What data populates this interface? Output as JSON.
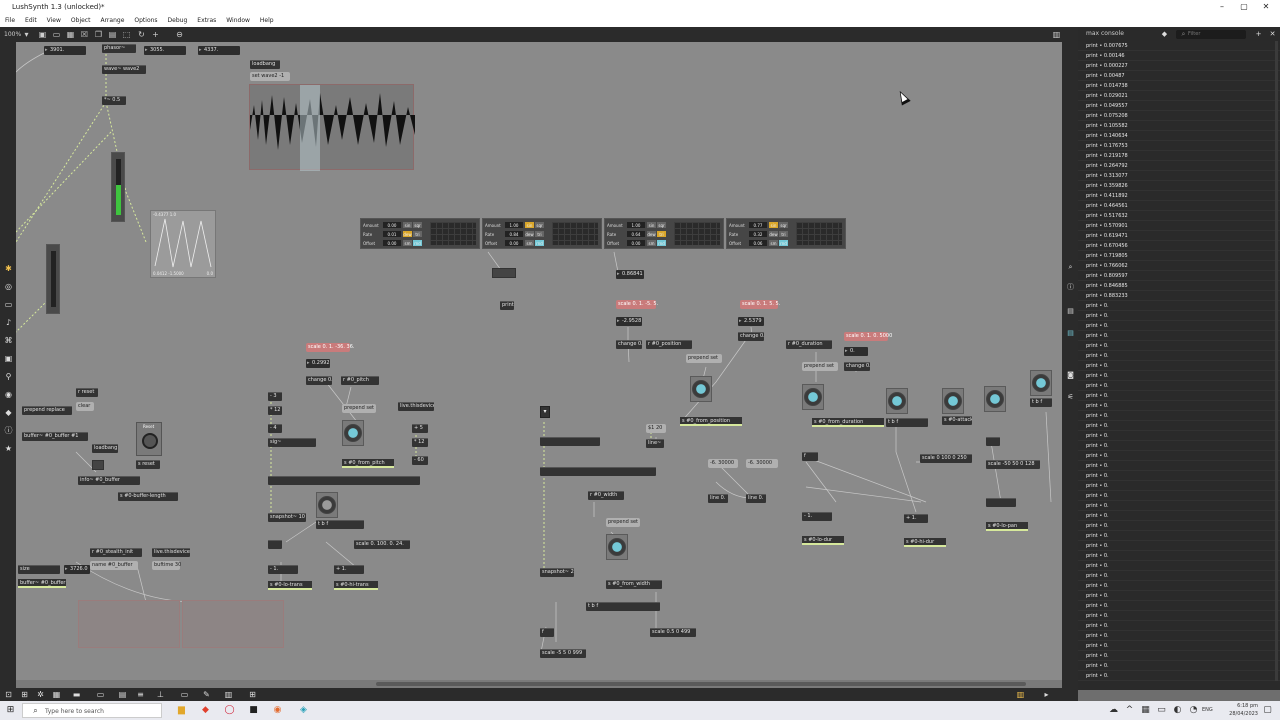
{
  "window": {
    "title": "LushSynth 1.3 (unlocked)*"
  },
  "menu": [
    "File",
    "Edit",
    "View",
    "Object",
    "Arrange",
    "Options",
    "Debug",
    "Extras",
    "Window",
    "Help"
  ],
  "toolbar": {
    "zoom": "100%"
  },
  "console": {
    "title": "max console",
    "filter_placeholder": "Filter",
    "lines": [
      "print • 0.007675",
      "print • 0.00146",
      "print • 0.000227",
      "print • 0.00487",
      "print • 0.014738",
      "print • 0.029021",
      "print • 0.049557",
      "print • 0.075208",
      "print • 0.105582",
      "print • 0.140634",
      "print • 0.176753",
      "print • 0.219178",
      "print • 0.264792",
      "print • 0.313077",
      "print • 0.359826",
      "print • 0.411892",
      "print • 0.464561",
      "print • 0.517632",
      "print • 0.570901",
      "print • 0.619471",
      "print • 0.670456",
      "print • 0.719805",
      "print • 0.766062",
      "print • 0.809597",
      "print • 0.846885",
      "print • 0.883233",
      "print • 0.",
      "print • 0.",
      "print • 0.",
      "print • 0.",
      "print • 0.",
      "print • 0.",
      "print • 0.",
      "print • 0.",
      "print • 0.",
      "print • 0.",
      "print • 0.",
      "print • 0.",
      "print • 0.",
      "print • 0.",
      "print • 0.",
      "print • 0.",
      "print • 0.",
      "print • 0.",
      "print • 0.",
      "print • 0.",
      "print • 0.",
      "print • 0.",
      "print • 0.",
      "print • 0.",
      "print • 0.",
      "print • 0.",
      "print • 0.",
      "print • 0.",
      "print • 0.",
      "print • 0.",
      "print • 0.",
      "print • 0.",
      "print • 0.",
      "print • 0.",
      "print • 0.",
      "print • 0.",
      "print • 0.",
      "print • 0."
    ]
  },
  "patch": {
    "top": {
      "num1": "3901.",
      "phasor": "phasor~",
      "num2": "3055.",
      "num3": "4337.",
      "wave": "wave~ wave2",
      "mult": "*~ 0.5",
      "loadbang": "loadbang",
      "set": "set wave2 -1"
    },
    "scope": {
      "range": "-0.4377 1.0",
      "left": "0.0412 -1.5000",
      "right": "0.0"
    },
    "lfo_panels": [
      {
        "amount": "0.00",
        "rate": "0.01",
        "offset": "0.00"
      },
      {
        "amount": "1.00",
        "rate": "0.84",
        "offset": "0.00"
      },
      {
        "amount": "1.00",
        "rate": "0.64",
        "offset": "0.00"
      },
      {
        "amount": "0.77",
        "rate": "0.32",
        "offset": "0.06"
      }
    ],
    "panel_labels": {
      "amount": "Amount",
      "rate": "Rate",
      "offset": "Offset",
      "sin": "sin",
      "sm": "sm",
      "dew": "dew",
      "tri": "tri",
      "sqr": "sqr",
      "rnd": "rnd"
    },
    "mid": {
      "num_a": "0.86841",
      "print": "print",
      "scale_a": "scale 0. 1. -5. 5.",
      "scale_b": "scale 0. 1. 5. 5.",
      "num_b": "-2.9528",
      "num_c": "2.5379",
      "change1": "change 0.",
      "change2": "change 0.",
      "r_position": "r #0_position",
      "prepend_set1": "prepend set",
      "s_from_position": "s #0_from_position",
      "msg_120": "$1 20",
      "line": "line~"
    },
    "pitch": {
      "scale": "scale 0. 1. -36. 36.",
      "num": "0.2992",
      "change": "change 0.",
      "r_pitch": "r #0_pitch",
      "prepend": "prepend set",
      "live": "live.thisdevice",
      "s_from_pitch": "s #0_from_pitch",
      "snapshot": "snapshot~ 10",
      "tbf": "t b f",
      "scale2": "scale 0. 100. 0. 24.",
      "minus1": "- 1.",
      "plus1": "+ 1.",
      "s_lo": "s #0-lo-trans",
      "s_hi": "s #0-hi-trans",
      "m3": "- 3",
      "m12": "* 12",
      "d4": "- 4",
      "p5": "+ 5",
      "p12": "* 12",
      "p60": "- 60",
      "sig": "sig~"
    },
    "buffer": {
      "r_reset": "r reset",
      "clear": "clear",
      "prepend_replace": "prepend replace",
      "buffer": "buffer~ #0_buffer #1",
      "loadbang": "loadbang",
      "reset_label": "Reset",
      "s_reset": "s reset",
      "info": "info~ #0_buffer",
      "s_len": "s #0-buffer-length",
      "size": "size",
      "num": "3726.0",
      "buffer2": "buffer~ #0_buffer",
      "r_stealth": "r #0_stealth_init",
      "name": "name #0_buffer",
      "live": "live.thisdevice",
      "buftime": "buftime 30"
    },
    "width": {
      "r_width": "r #0_width",
      "prepend": "prepend set",
      "s_from_width": "s #0_from_width",
      "snapshot": "snapshot~ 2",
      "tbf": "t b f",
      "f": "f",
      "scale": "scale 0.5 0 499",
      "scale2": "scale -5 5 0 999",
      "line0": "line 0.",
      "line1": "line 0.",
      "m1": "-6. 30000",
      "m2": "-6. 30000"
    },
    "duration": {
      "r_duration": "r #0_duration",
      "prepend": "prepend set",
      "change": "change 0.",
      "scale": "scale 0. 1. 0. 5000",
      "num": "0.",
      "s_from_duration": "s #0_from_duration",
      "tbf": "t b f",
      "s_attack": "s #0-attack",
      "scale2": "scale 0 100 0 250",
      "scale3": "scale -50 50 0 128",
      "s_lo_dur": "s #0-lo-dur",
      "s_hi_dur": "s #0-hi-dur",
      "s_lo_pan": "s #0-lo-pan",
      "m1": "- 1.",
      "p1": "+ 1.",
      "tbf2": "t b f",
      "f": "f"
    }
  },
  "taskbar": {
    "search_placeholder": "Type here to search",
    "lang": "ENG",
    "time": "6:18 pm",
    "date": "28/04/2023"
  },
  "colors": {
    "canvas": "#8a8a8a",
    "object": "#333333",
    "send_underline": "#d6e89c",
    "pink_message": "#c97b7b",
    "dial": "#74c8d6",
    "meter": "#3ec43e"
  }
}
